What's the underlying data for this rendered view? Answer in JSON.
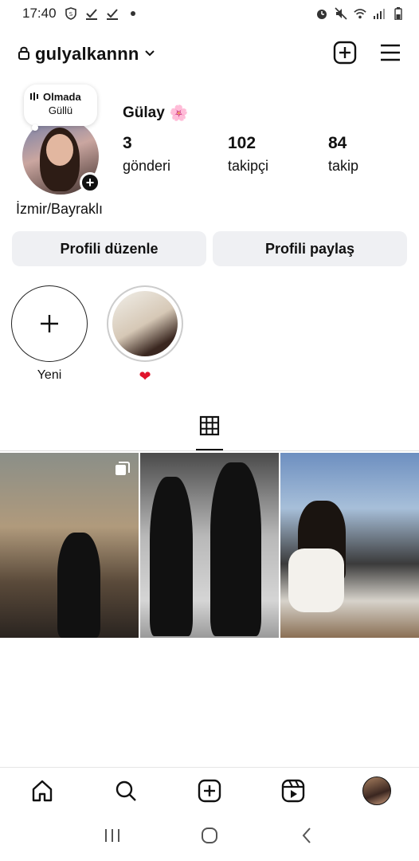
{
  "status_bar": {
    "time": "17:40"
  },
  "header": {
    "username": "gulyalkannn"
  },
  "note": {
    "title": "Olmada",
    "subtitle": "Güllü"
  },
  "profile": {
    "display_name": "Gülay",
    "display_emoji": "🌸",
    "bio": "İzmir/Bayraklı",
    "stats": {
      "posts_count": "3",
      "posts_label": "gönderi",
      "followers_count": "102",
      "followers_label": "takipçi",
      "following_count": "84",
      "following_label": "takip"
    }
  },
  "buttons": {
    "edit_profile": "Profili düzenle",
    "share_profile": "Profili paylaş"
  },
  "highlights": [
    {
      "label": "Yeni"
    },
    {
      "label": "❤"
    }
  ],
  "colors": {
    "button_bg": "#eff0f3",
    "heart": "#e0142c",
    "text": "#111111"
  }
}
